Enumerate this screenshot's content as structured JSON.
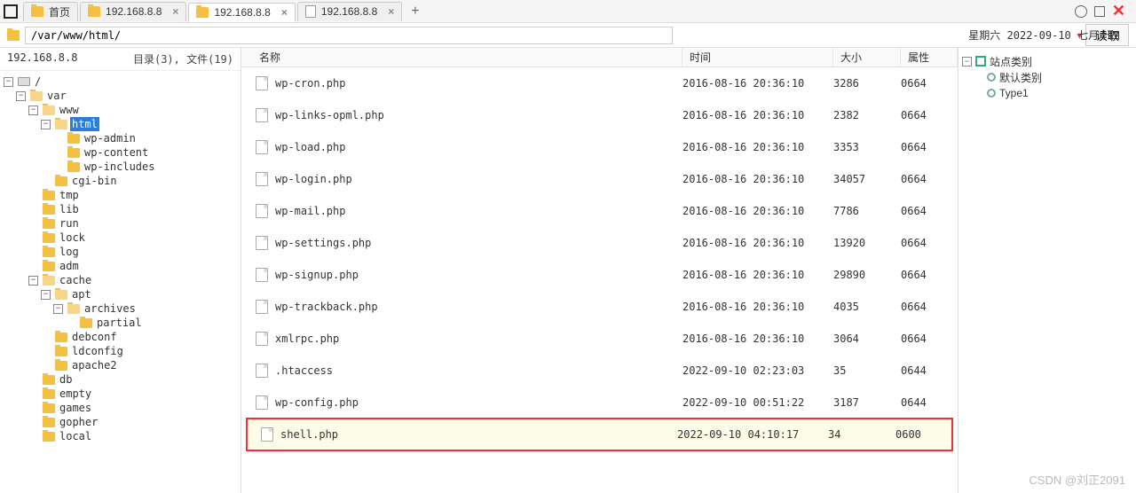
{
  "tabs": {
    "items": [
      {
        "label": "首页",
        "icon": "folder"
      },
      {
        "label": "192.168.8.8",
        "icon": "folder"
      },
      {
        "label": "192.168.8.8",
        "icon": "folder",
        "active": true
      },
      {
        "label": "192.168.8.8",
        "icon": "file"
      }
    ]
  },
  "address": {
    "path": "/var/www/html/",
    "read_btn": "读取",
    "date_info": "星期六 2022-09-10 七月十四",
    "combo_glyph": "▾"
  },
  "left": {
    "host": "192.168.8.8",
    "stats": "目录(3), 文件(19)"
  },
  "tree": [
    {
      "indent": 0,
      "toggle": "-",
      "icon": "disk",
      "label": "/",
      "sel": false
    },
    {
      "indent": 1,
      "toggle": "-",
      "icon": "folder-open",
      "label": "var",
      "sel": false
    },
    {
      "indent": 2,
      "toggle": "-",
      "icon": "folder-open",
      "label": "www",
      "sel": false
    },
    {
      "indent": 3,
      "toggle": "-",
      "icon": "folder-open",
      "label": "html",
      "sel": true
    },
    {
      "indent": 4,
      "toggle": " ",
      "icon": "folder",
      "label": "wp-admin",
      "sel": false
    },
    {
      "indent": 4,
      "toggle": " ",
      "icon": "folder",
      "label": "wp-content",
      "sel": false
    },
    {
      "indent": 4,
      "toggle": " ",
      "icon": "folder",
      "label": "wp-includes",
      "sel": false
    },
    {
      "indent": 3,
      "toggle": " ",
      "icon": "folder",
      "label": "cgi-bin",
      "sel": false
    },
    {
      "indent": 2,
      "toggle": " ",
      "icon": "folder",
      "label": "tmp",
      "sel": false
    },
    {
      "indent": 2,
      "toggle": " ",
      "icon": "folder",
      "label": "lib",
      "sel": false
    },
    {
      "indent": 2,
      "toggle": " ",
      "icon": "folder",
      "label": "run",
      "sel": false
    },
    {
      "indent": 2,
      "toggle": " ",
      "icon": "folder",
      "label": "lock",
      "sel": false
    },
    {
      "indent": 2,
      "toggle": " ",
      "icon": "folder",
      "label": "log",
      "sel": false
    },
    {
      "indent": 2,
      "toggle": " ",
      "icon": "folder",
      "label": "adm",
      "sel": false
    },
    {
      "indent": 2,
      "toggle": "-",
      "icon": "folder-open",
      "label": "cache",
      "sel": false
    },
    {
      "indent": 3,
      "toggle": "-",
      "icon": "folder-open",
      "label": "apt",
      "sel": false
    },
    {
      "indent": 4,
      "toggle": "-",
      "icon": "folder-open",
      "label": "archives",
      "sel": false
    },
    {
      "indent": 5,
      "toggle": " ",
      "icon": "folder",
      "label": "partial",
      "sel": false
    },
    {
      "indent": 3,
      "toggle": " ",
      "icon": "folder",
      "label": "debconf",
      "sel": false
    },
    {
      "indent": 3,
      "toggle": " ",
      "icon": "folder",
      "label": "ldconfig",
      "sel": false
    },
    {
      "indent": 3,
      "toggle": " ",
      "icon": "folder",
      "label": "apache2",
      "sel": false
    },
    {
      "indent": 2,
      "toggle": " ",
      "icon": "folder",
      "label": "db",
      "sel": false
    },
    {
      "indent": 2,
      "toggle": " ",
      "icon": "folder",
      "label": "empty",
      "sel": false
    },
    {
      "indent": 2,
      "toggle": " ",
      "icon": "folder",
      "label": "games",
      "sel": false
    },
    {
      "indent": 2,
      "toggle": " ",
      "icon": "folder",
      "label": "gopher",
      "sel": false
    },
    {
      "indent": 2,
      "toggle": " ",
      "icon": "folder",
      "label": "local",
      "sel": false
    }
  ],
  "columns": {
    "name": "名称",
    "time": "时间",
    "size": "大小",
    "attr": "属性"
  },
  "files": [
    {
      "name": "wp-cron.php",
      "time": "2016-08-16 20:36:10",
      "size": "3286",
      "attr": "0664"
    },
    {
      "name": "wp-links-opml.php",
      "time": "2016-08-16 20:36:10",
      "size": "2382",
      "attr": "0664"
    },
    {
      "name": "wp-load.php",
      "time": "2016-08-16 20:36:10",
      "size": "3353",
      "attr": "0664"
    },
    {
      "name": "wp-login.php",
      "time": "2016-08-16 20:36:10",
      "size": "34057",
      "attr": "0664"
    },
    {
      "name": "wp-mail.php",
      "time": "2016-08-16 20:36:10",
      "size": "7786",
      "attr": "0664"
    },
    {
      "name": "wp-settings.php",
      "time": "2016-08-16 20:36:10",
      "size": "13920",
      "attr": "0664"
    },
    {
      "name": "wp-signup.php",
      "time": "2016-08-16 20:36:10",
      "size": "29890",
      "attr": "0664"
    },
    {
      "name": "wp-trackback.php",
      "time": "2016-08-16 20:36:10",
      "size": "4035",
      "attr": "0664"
    },
    {
      "name": "xmlrpc.php",
      "time": "2016-08-16 20:36:10",
      "size": "3064",
      "attr": "0664"
    },
    {
      "name": ".htaccess",
      "time": "2022-09-10 02:23:03",
      "size": "35",
      "attr": "0644"
    },
    {
      "name": "wp-config.php",
      "time": "2022-09-10 00:51:22",
      "size": "3187",
      "attr": "0644"
    },
    {
      "name": "shell.php",
      "time": "2022-09-10 04:10:17",
      "size": "34",
      "attr": "0600",
      "hl": true
    }
  ],
  "right": {
    "root": "站点类别",
    "items": [
      "默认类别",
      "Type1"
    ]
  },
  "watermark": "CSDN @刘正2091"
}
